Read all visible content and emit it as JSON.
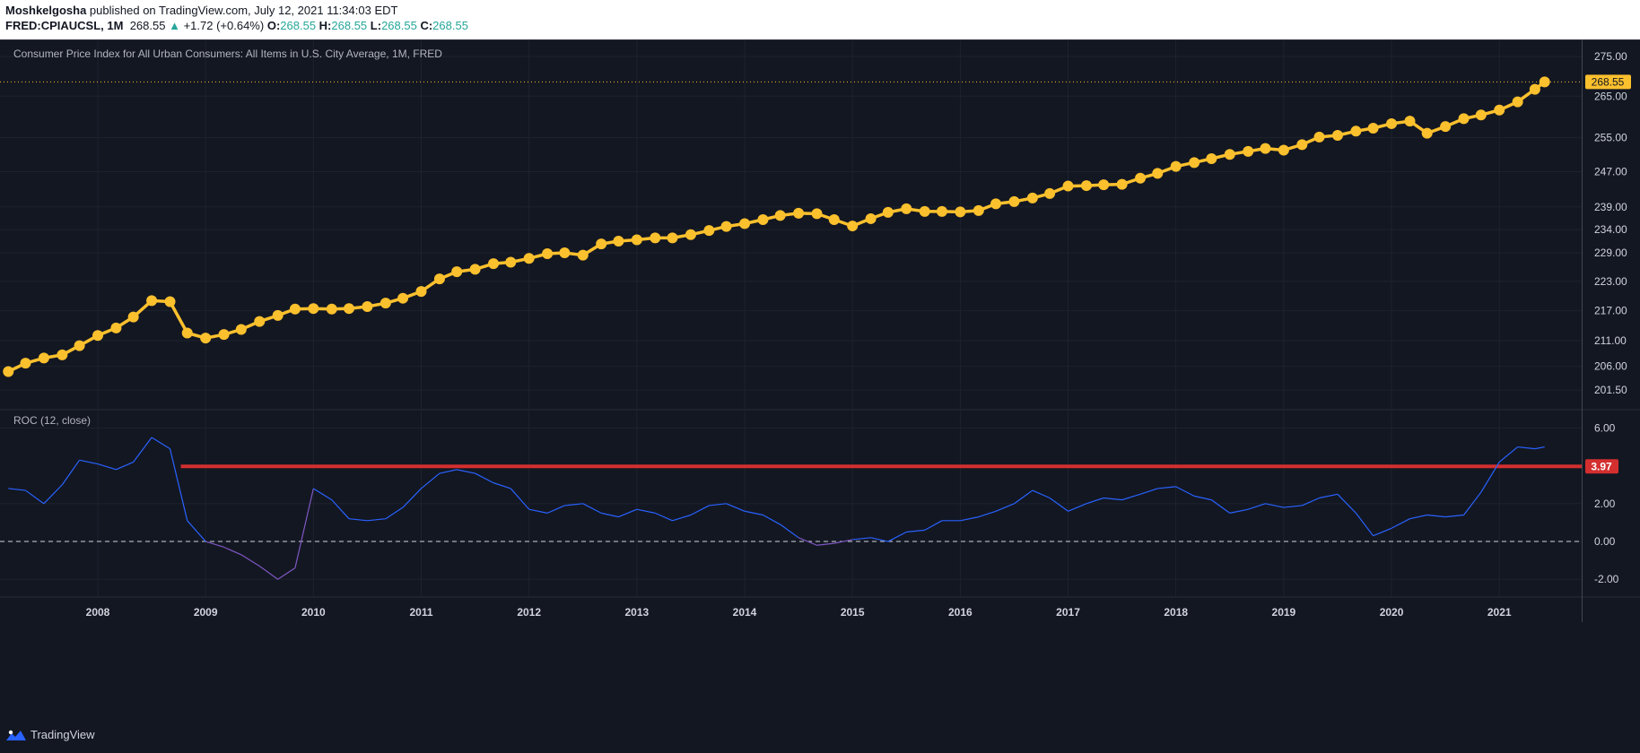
{
  "header": {
    "author": "Moshkelgosha",
    "published_text": "published on TradingView.com, July 12, 2021 11:34:03 EDT",
    "symbol": "FRED:CPIAUCSL, 1M",
    "last": "268.55",
    "change_arrow": "▲",
    "change": "+1.72 (+0.64%)",
    "o_label": "O:",
    "o_value": "268.55",
    "h_label": "H:",
    "h_value": "268.55",
    "l_label": "L:",
    "l_value": "268.55",
    "c_label": "C:",
    "c_value": "268.55"
  },
  "footer": {
    "brand": "TradingView",
    "logo_icon": "tradingview-logo-icon"
  },
  "colors": {
    "background": "#131722",
    "price": "#fbc02d",
    "roc": "#2962ff",
    "roc_negative": "#7e57c2",
    "level": "#d32f2f"
  },
  "chart_data": [
    {
      "type": "line",
      "title": "Consumer Price Index for All Urban Consumers: All Items in U.S. City Average, 1M, FRED",
      "marker": "circle",
      "x_ticks": [
        "2008",
        "2009",
        "2010",
        "2011",
        "2012",
        "2013",
        "2014",
        "2015",
        "2016",
        "2017",
        "2018",
        "2019",
        "2020",
        "2021"
      ],
      "y_ticks": [
        "275.00",
        "265.00",
        "255.00",
        "247.00",
        "239.00",
        "234.00",
        "229.00",
        "223.00",
        "217.00",
        "211.00",
        "206.00",
        "201.50"
      ],
      "ylim": [
        199,
        278
      ],
      "scale": "log",
      "last_value_label": "268.55",
      "x": [
        2007.17,
        2007.33,
        2007.5,
        2007.67,
        2007.83,
        2008.0,
        2008.17,
        2008.33,
        2008.5,
        2008.67,
        2008.83,
        2009.0,
        2009.17,
        2009.33,
        2009.5,
        2009.67,
        2009.83,
        2010.0,
        2010.17,
        2010.33,
        2010.5,
        2010.67,
        2010.83,
        2011.0,
        2011.17,
        2011.33,
        2011.5,
        2011.67,
        2011.83,
        2012.0,
        2012.17,
        2012.33,
        2012.5,
        2012.67,
        2012.83,
        2013.0,
        2013.17,
        2013.33,
        2013.5,
        2013.67,
        2013.83,
        2014.0,
        2014.17,
        2014.33,
        2014.5,
        2014.67,
        2014.83,
        2015.0,
        2015.17,
        2015.33,
        2015.5,
        2015.67,
        2015.83,
        2016.0,
        2016.17,
        2016.33,
        2016.5,
        2016.67,
        2016.83,
        2017.0,
        2017.17,
        2017.33,
        2017.5,
        2017.67,
        2017.83,
        2018.0,
        2018.17,
        2018.33,
        2018.5,
        2018.67,
        2018.83,
        2019.0,
        2019.17,
        2019.33,
        2019.5,
        2019.67,
        2019.83,
        2020.0,
        2020.17,
        2020.33,
        2020.5,
        2020.67,
        2020.83,
        2021.0,
        2021.17,
        2021.33,
        2021.42
      ],
      "values": [
        205.0,
        206.6,
        207.6,
        208.2,
        210.0,
        212.0,
        213.5,
        215.7,
        219.0,
        218.8,
        212.5,
        211.5,
        212.2,
        213.2,
        214.8,
        216.0,
        217.3,
        217.4,
        217.3,
        217.4,
        217.8,
        218.5,
        219.5,
        220.9,
        223.5,
        225.0,
        225.5,
        226.7,
        227.0,
        227.8,
        228.8,
        229.0,
        228.5,
        230.9,
        231.5,
        231.8,
        232.2,
        232.2,
        232.9,
        233.8,
        234.7,
        235.3,
        236.2,
        237.1,
        237.6,
        237.5,
        236.2,
        234.8,
        236.4,
        237.8,
        238.6,
        238.0,
        238.0,
        237.9,
        238.2,
        239.7,
        240.2,
        241.0,
        242.0,
        243.7,
        243.8,
        244.0,
        244.1,
        245.5,
        246.6,
        248.2,
        249.1,
        250.0,
        251.0,
        251.7,
        252.4,
        252.0,
        253.3,
        255.1,
        255.5,
        256.5,
        257.2,
        258.3,
        258.9,
        256.0,
        257.6,
        259.5,
        260.4,
        261.6,
        263.6,
        266.7,
        268.55
      ]
    },
    {
      "type": "line",
      "title": "ROC (12, close)",
      "y_ticks": [
        "6.00",
        "2.00",
        "0.00",
        "-2.00"
      ],
      "ylim": [
        -2.7,
        6.4
      ],
      "zero_line": 0.0,
      "level_label": "3.97",
      "level_value": 3.97,
      "x": [
        2007.17,
        2007.33,
        2007.5,
        2007.67,
        2007.83,
        2008.0,
        2008.17,
        2008.33,
        2008.5,
        2008.67,
        2008.83,
        2009.0,
        2009.17,
        2009.33,
        2009.5,
        2009.67,
        2009.83,
        2010.0,
        2010.17,
        2010.33,
        2010.5,
        2010.67,
        2010.83,
        2011.0,
        2011.17,
        2011.33,
        2011.5,
        2011.67,
        2011.83,
        2012.0,
        2012.17,
        2012.33,
        2012.5,
        2012.67,
        2012.83,
        2013.0,
        2013.17,
        2013.33,
        2013.5,
        2013.67,
        2013.83,
        2014.0,
        2014.17,
        2014.33,
        2014.5,
        2014.67,
        2014.83,
        2015.0,
        2015.17,
        2015.33,
        2015.5,
        2015.67,
        2015.83,
        2016.0,
        2016.17,
        2016.33,
        2016.5,
        2016.67,
        2016.83,
        2017.0,
        2017.17,
        2017.33,
        2017.5,
        2017.67,
        2017.83,
        2018.0,
        2018.17,
        2018.33,
        2018.5,
        2018.67,
        2018.83,
        2019.0,
        2019.17,
        2019.33,
        2019.5,
        2019.67,
        2019.83,
        2020.0,
        2020.17,
        2020.33,
        2020.5,
        2020.67,
        2020.83,
        2021.0,
        2021.17,
        2021.33,
        2021.42
      ],
      "values": [
        2.8,
        2.7,
        2.0,
        3.0,
        4.3,
        4.1,
        3.8,
        4.2,
        5.5,
        4.9,
        1.1,
        0.0,
        -0.3,
        -0.7,
        -1.3,
        -2.0,
        -1.4,
        2.8,
        2.2,
        1.2,
        1.1,
        1.2,
        1.8,
        2.8,
        3.6,
        3.8,
        3.6,
        3.1,
        2.8,
        1.7,
        1.5,
        1.9,
        2.0,
        1.5,
        1.3,
        1.7,
        1.5,
        1.1,
        1.4,
        1.9,
        2.0,
        1.6,
        1.4,
        0.9,
        0.2,
        -0.2,
        -0.1,
        0.1,
        0.2,
        0.0,
        0.5,
        0.6,
        1.1,
        1.1,
        1.3,
        1.6,
        2.0,
        2.7,
        2.3,
        1.6,
        2.0,
        2.3,
        2.2,
        2.5,
        2.8,
        2.9,
        2.4,
        2.2,
        1.5,
        1.7,
        2.0,
        1.8,
        1.9,
        2.3,
        2.5,
        1.5,
        0.3,
        0.7,
        1.2,
        1.4,
        1.3,
        1.4,
        2.6,
        4.2,
        5.0,
        4.9,
        5.0
      ]
    }
  ]
}
